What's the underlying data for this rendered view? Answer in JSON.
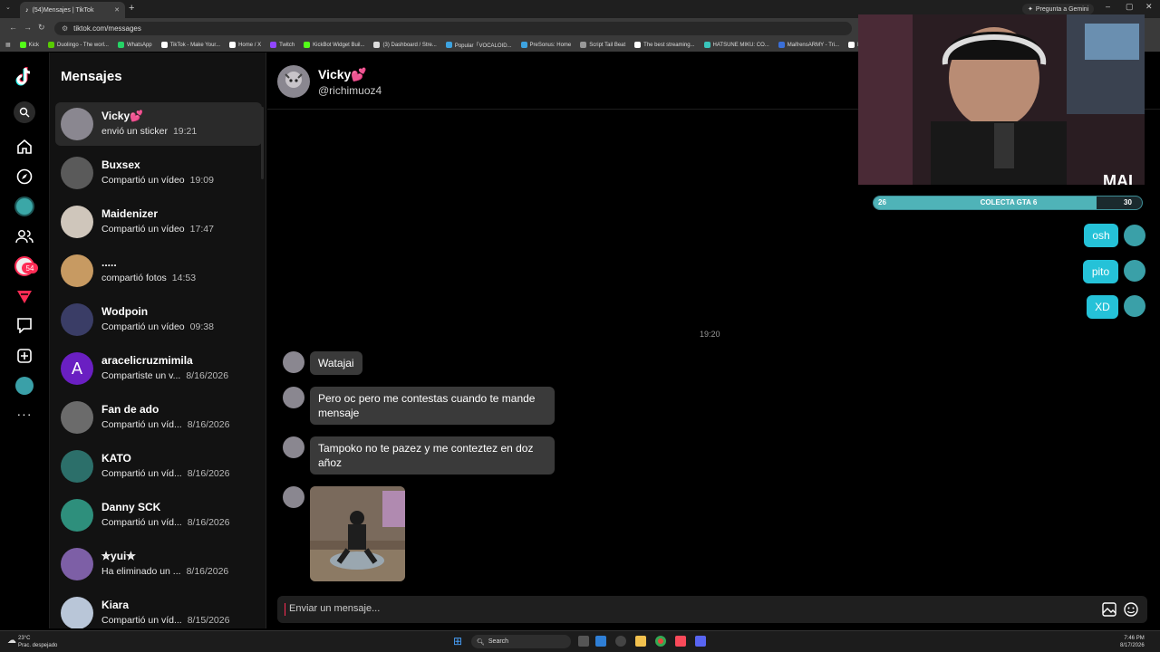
{
  "browser": {
    "tab_title": "(54)Mensajes | TikTok",
    "url": "tiktok.com/messages",
    "gemini_label": "Pregunta a Gemini",
    "bookmarks": [
      {
        "label": "Kick",
        "color": "#53fc18"
      },
      {
        "label": "Duolingo - The worl...",
        "color": "#58cc02"
      },
      {
        "label": "WhatsApp",
        "color": "#25d366"
      },
      {
        "label": "TikTok - Make Your...",
        "color": "#ffffff"
      },
      {
        "label": "Home / X",
        "color": "#ffffff"
      },
      {
        "label": "Twitch",
        "color": "#9146ff"
      },
      {
        "label": "KickBot Widget Buil...",
        "color": "#53fc18"
      },
      {
        "label": "(3) Dashboard / Stre...",
        "color": "#dddddd"
      },
      {
        "label": "Popular「VOCALOID...",
        "color": "#3da3e0"
      },
      {
        "label": "PreSonus: Home",
        "color": "#3da3e0"
      },
      {
        "label": "Script Tail Beat",
        "color": "#999999"
      },
      {
        "label": "The best streaming...",
        "color": "#ffffff"
      },
      {
        "label": "HATSUNE MIKU: CO...",
        "color": "#39c5bb"
      },
      {
        "label": "MaifrensARMY - Tri...",
        "color": "#3a6fd8"
      },
      {
        "label": "Inicio",
        "color": "#ffffff"
      }
    ]
  },
  "nav": {
    "notification_count": "54"
  },
  "conversations_title": "Mensajes",
  "conversations": [
    {
      "name": "Vicky💕",
      "preview": "envió un sticker",
      "time": "19:21",
      "avatar": "#8a8790"
    },
    {
      "name": "Buxsex",
      "preview": "Compartió un vídeo",
      "time": "19:09",
      "avatar": "#5a5a5a"
    },
    {
      "name": "Maidenizer",
      "preview": "Compartió un vídeo",
      "time": "17:47",
      "avatar": "#cfc6bb"
    },
    {
      "name": ".....",
      "preview": "compartió fotos",
      "time": "14:53",
      "avatar": "#c79a62"
    },
    {
      "name": "Wodpoin",
      "preview": "Compartió un vídeo",
      "time": "09:38",
      "avatar": "#3a3d66"
    },
    {
      "name": "aracelicruzmimila",
      "preview": "Compartiste un v...",
      "time": "8/16/2026",
      "avatar": "#6a1fc2",
      "initial": "A"
    },
    {
      "name": "Fan de ado",
      "preview": "Compartió un víd...",
      "time": "8/16/2026",
      "avatar": "#6b6b6b"
    },
    {
      "name": "KATO",
      "preview": "Compartió un víd...",
      "time": "8/16/2026",
      "avatar": "#2c6f6a"
    },
    {
      "name": "Danny SCK",
      "preview": "Compartió un víd...",
      "time": "8/16/2026",
      "avatar": "#2e8f7c"
    },
    {
      "name": "✮yui✮",
      "preview": "Ha eliminado un ...",
      "time": "8/16/2026",
      "avatar": "#7d5fa6"
    },
    {
      "name": "Kiara",
      "preview": "Compartió un víd...",
      "time": "8/15/2026",
      "avatar": "#b9c6d8"
    }
  ],
  "chat": {
    "name": "Vicky💕",
    "username": "@richimuoz4",
    "timestamp": "19:20",
    "received": [
      "Watajai",
      "Pero oc pero me contestas cuando te mande mensaje",
      "Tampoko no te pazez y me conteztez en doz añoz"
    ],
    "sent": [
      "osh",
      "pito",
      "XD"
    ],
    "input_placeholder": "Enviar un mensaje..."
  },
  "overlay": {
    "progress_left": "26",
    "progress_label": "COLECTA GTA 6",
    "progress_right": "30",
    "progress_fraction": 0.83,
    "logo_text": "MAI"
  },
  "taskbar": {
    "temperature": "23°C",
    "weather": "Prac. despejado",
    "search": "Search",
    "time": "7:46 PM",
    "date": "8/17/2026"
  }
}
